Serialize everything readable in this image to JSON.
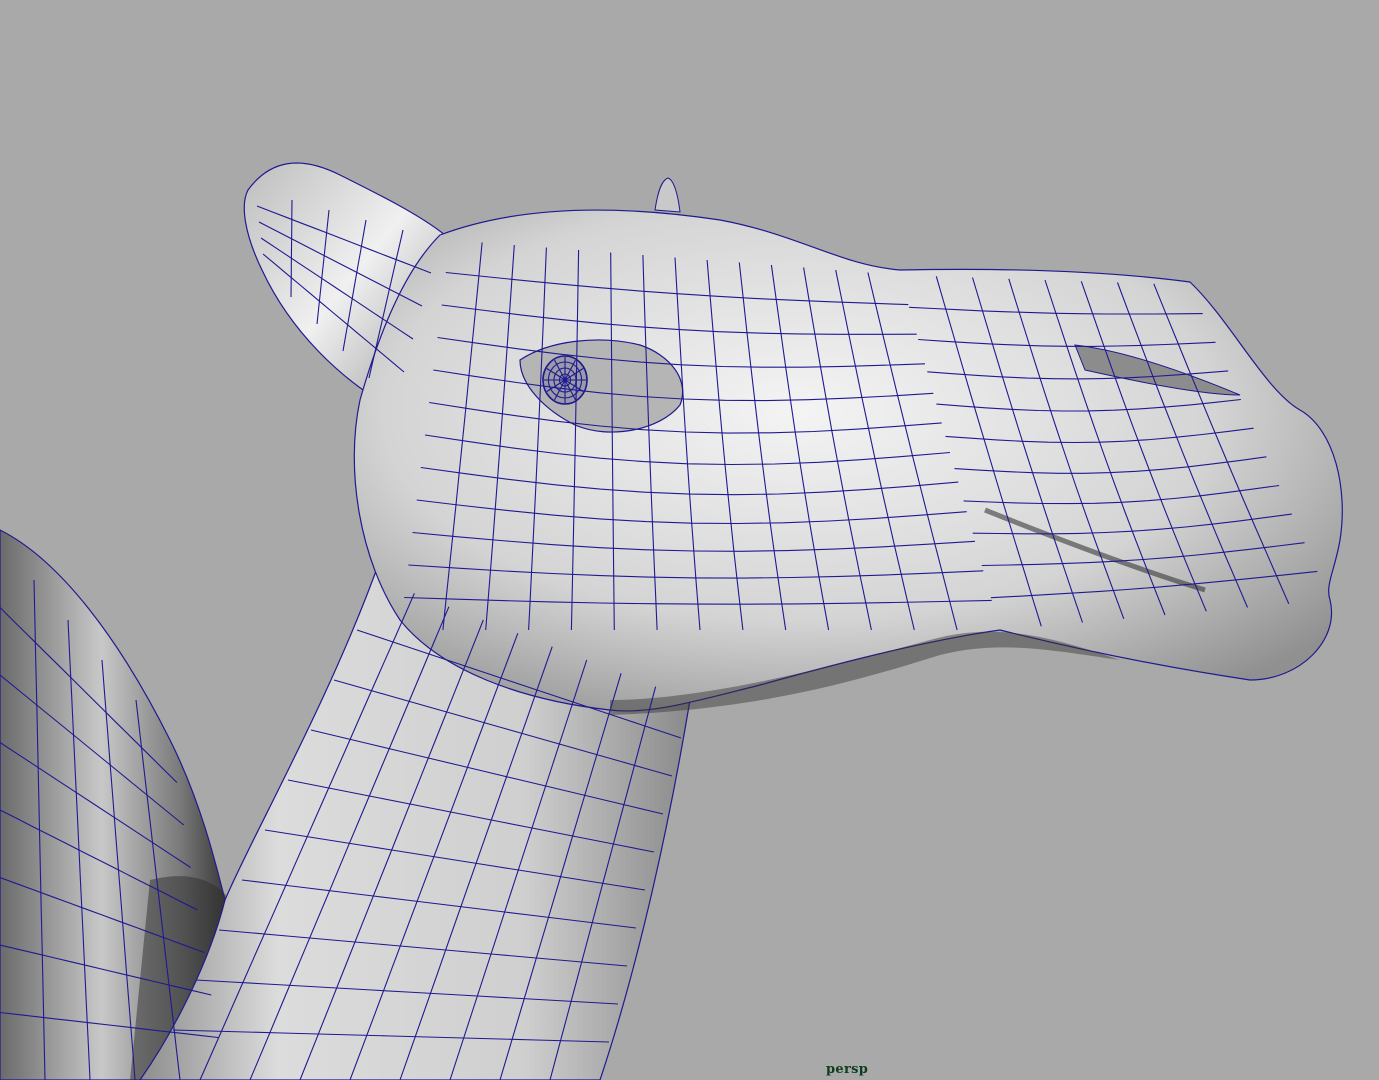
{
  "viewport": {
    "camera_name": "persp",
    "background_color": "#a9a9a9",
    "wireframe_color": "#1f1a8f",
    "label_color": "#0d3d1c"
  },
  "model": {
    "icon": "camel-head-mesh-icon"
  }
}
